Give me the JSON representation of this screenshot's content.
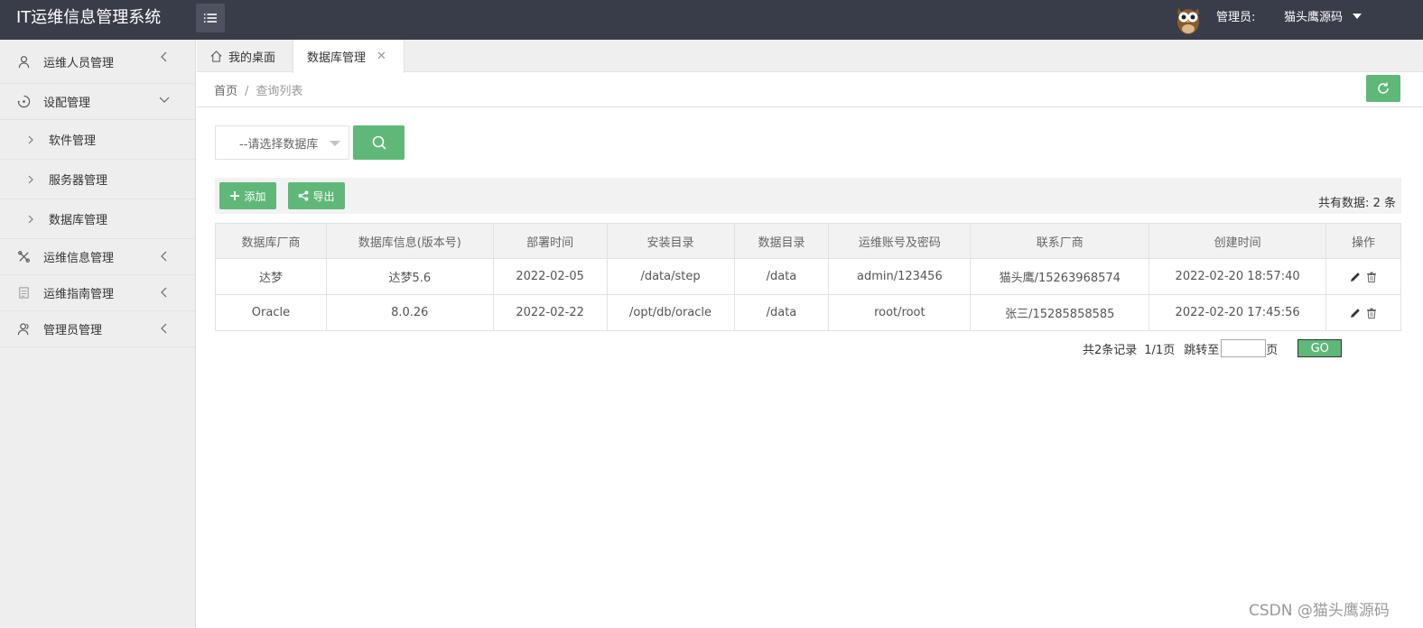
{
  "header": {
    "app_title": "IT运维信息管理系统",
    "admin_label": "管理员:",
    "admin_name": "猫头鹰源码"
  },
  "sidebar": {
    "items": [
      {
        "label": "运维人员管理",
        "icon": "user-icon",
        "state": "collapsed"
      },
      {
        "label": "设配管理",
        "icon": "target-icon",
        "state": "expanded",
        "children": [
          {
            "label": "软件管理"
          },
          {
            "label": "服务器管理"
          },
          {
            "label": "数据库管理"
          }
        ]
      },
      {
        "label": "运维信息管理",
        "icon": "tools-icon",
        "state": "collapsed"
      },
      {
        "label": "运维指南管理",
        "icon": "document-icon",
        "state": "collapsed"
      },
      {
        "label": "管理员管理",
        "icon": "users-icon",
        "state": "collapsed"
      }
    ]
  },
  "tabs": [
    {
      "label": "我的桌面",
      "icon": "home-icon"
    },
    {
      "label": "数据库管理",
      "active": true
    }
  ],
  "breadcrumb": {
    "home": "首页",
    "separator": "/",
    "current": "查询列表"
  },
  "search": {
    "select_placeholder": "--请选择数据库"
  },
  "toolbar": {
    "add_label": "添加",
    "export_label": "导出",
    "total_label": "共有数据:",
    "total_count": "2",
    "total_unit": "条"
  },
  "table": {
    "headers": [
      "数据库厂商",
      "数据库信息(版本号)",
      "部署时间",
      "安装目录",
      "数据目录",
      "运维账号及密码",
      "联系厂商",
      "创建时间",
      "操作"
    ],
    "rows": [
      [
        "达梦",
        "达梦5.6",
        "2022-02-05",
        "/data/step",
        "/data",
        "admin/123456",
        "猫头鹰/15263968574",
        "2022-02-20 18:57:40"
      ],
      [
        "Oracle",
        "8.0.26",
        "2022-02-22",
        "/opt/db/oracle",
        "/data",
        "root/root",
        "张三/15285858585",
        "2022-02-20 17:45:56"
      ]
    ]
  },
  "pagination": {
    "records": "共2条记录",
    "pages": "1/1页",
    "jump_label": "跳转至",
    "page_unit": "页",
    "go_label": "GO"
  },
  "watermark": "CSDN @猫头鹰源码",
  "colors": {
    "header_bg": "#393d49",
    "accent": "#5fb878",
    "sidebar_bg": "#eeeeee"
  }
}
